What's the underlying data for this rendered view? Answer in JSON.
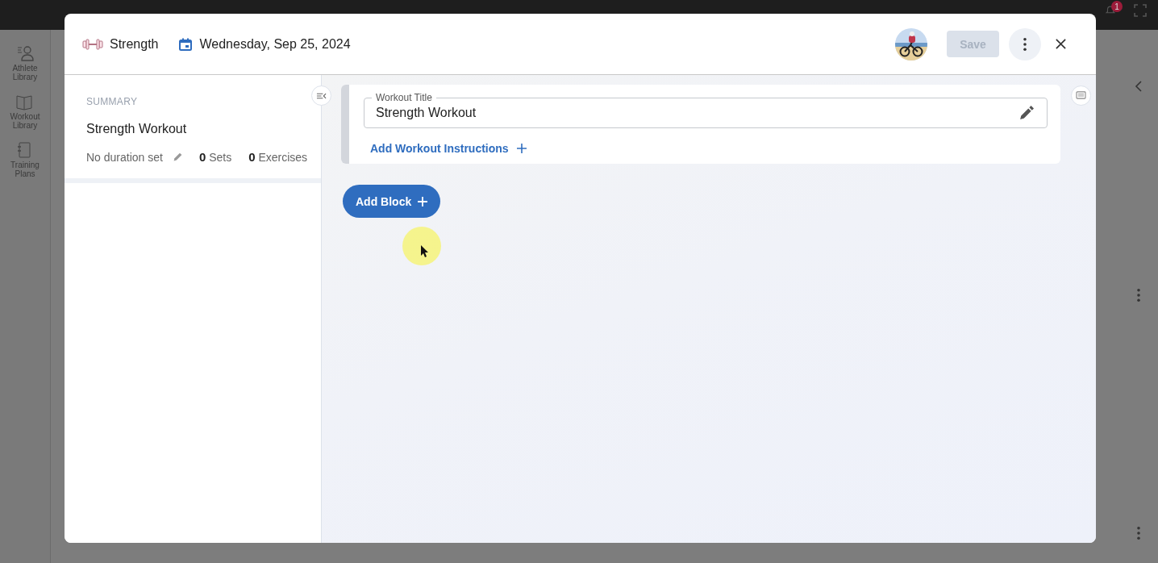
{
  "app_bar": {
    "notifications": "1"
  },
  "sidebar": {
    "items": [
      {
        "label": "Athlete Library",
        "kind": "athletes"
      },
      {
        "label": "Workout Library",
        "kind": "workouts"
      },
      {
        "label": "Training Plans",
        "kind": "plans"
      }
    ]
  },
  "modal": {
    "workout_type": "Strength",
    "date": "Wednesday, Sep 25, 2024",
    "save": {
      "label": "Save",
      "disabled": true
    },
    "summary": {
      "heading": "SUMMARY",
      "title": "Strength Workout",
      "duration": "No duration set",
      "counts": [
        {
          "count": "0",
          "label": "Sets"
        },
        {
          "count": "0",
          "label": "Exercises"
        }
      ]
    },
    "workout_title": {
      "label": "Workout Title",
      "value": "Strength Workout"
    },
    "instructions_link": "Add Workout Instructions",
    "add_block": "Add Block"
  }
}
